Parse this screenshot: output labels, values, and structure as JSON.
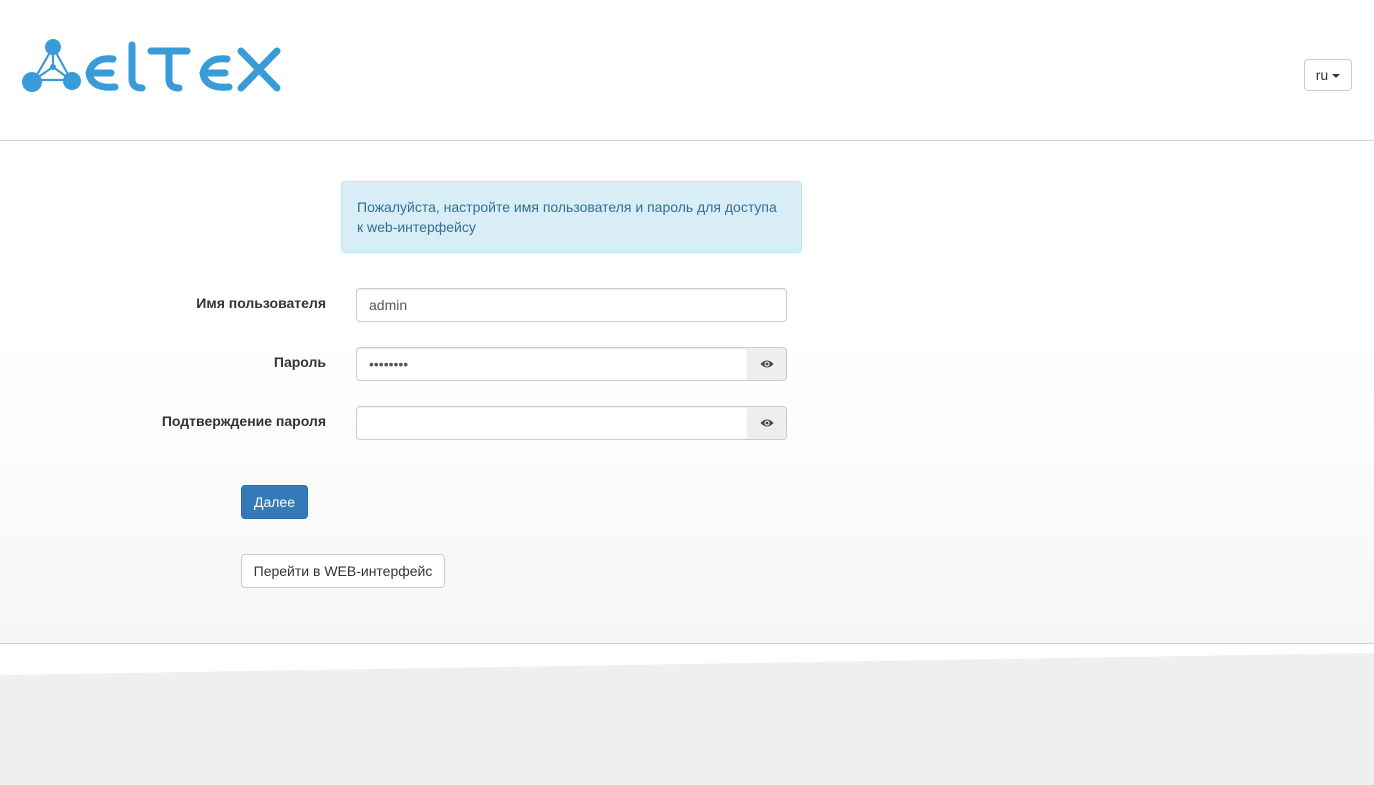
{
  "header": {
    "logo_text": "ELTEX",
    "language": {
      "selected": "ru"
    }
  },
  "alert": {
    "message": "Пожалуйста, настройте имя пользователя и пароль для доступа к web-интерфейсу"
  },
  "form": {
    "username": {
      "label": "Имя пользователя",
      "value": "admin"
    },
    "password": {
      "label": "Пароль",
      "value": "••••••••"
    },
    "confirm_password": {
      "label": "Подтверждение пароля",
      "value": ""
    }
  },
  "buttons": {
    "next": "Далее",
    "goto_web": "Перейти в WEB-интерфейс"
  },
  "colors": {
    "brand": "#3a9bd9",
    "primary": "#337ab7",
    "alert_bg": "#d9edf7",
    "alert_text": "#31708f"
  },
  "icons": {
    "password_toggle": "eye-icon",
    "confirm_toggle": "eye-icon",
    "language_caret": "caret-down-icon"
  }
}
